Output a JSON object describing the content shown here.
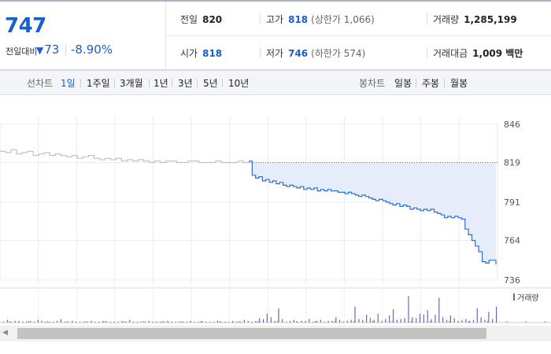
{
  "quote": {
    "price": "747",
    "change_label": "전일대비",
    "change_icon": "down-triangle-icon",
    "change_value": "73",
    "change_rate": "-8.90%",
    "prev_close_label": "전일",
    "prev_close": "820",
    "high_label": "고가",
    "high": "818",
    "upper_limit": "(상한가 1,066)",
    "volume_label": "거래량",
    "volume": "1,285,199",
    "open_label": "시가",
    "open": "818",
    "low_label": "저가",
    "low": "746",
    "lower_limit": "(하한가 574)",
    "amount_label": "거래대금",
    "amount": "1,009 백만"
  },
  "tabs": {
    "line_chart_label": "선차트",
    "line_periods": [
      "1일",
      "1주일",
      "3개월",
      "1년",
      "3년",
      "5년",
      "10년"
    ],
    "active_period": "1일",
    "candle_label": "봉차트",
    "candle_periods": [
      "일봉",
      "주봉",
      "월봉"
    ]
  },
  "colors": {
    "accent": "#1a5fd0",
    "today_line": "#2e6fd0",
    "prev_line": "#b7b7b7",
    "fill": "#e4edf9",
    "volume_bar": "#7b5fb5"
  },
  "chart_data": {
    "type": "line",
    "y_ticks": [
      "846",
      "819",
      "791",
      "764",
      "736"
    ],
    "ylim": [
      736,
      846
    ],
    "reference_value": 819,
    "legend": "거래량",
    "series": [
      {
        "values": [
          827,
          826,
          828,
          825,
          826,
          827,
          824,
          825,
          826,
          824,
          825,
          824,
          823,
          824,
          822,
          823,
          824,
          822,
          821,
          822,
          821,
          822,
          820,
          821,
          820,
          821,
          820,
          819,
          820,
          819,
          820,
          820,
          819,
          819,
          820,
          820,
          819,
          819,
          819,
          820,
          819,
          819,
          819,
          820,
          819,
          819
        ]
      },
      {
        "values": [
          820,
          810,
          808,
          809,
          806,
          807,
          805,
          806,
          804,
          805,
          803,
          802,
          803,
          802,
          801,
          802,
          800,
          801,
          800,
          801,
          799,
          800,
          799,
          800,
          799,
          799,
          798,
          798,
          797,
          798,
          797,
          796,
          795,
          796,
          795,
          794,
          793,
          792,
          793,
          792,
          791,
          790,
          789,
          790,
          788,
          789,
          788,
          786,
          787,
          786,
          785,
          786,
          785,
          786,
          784,
          783,
          782,
          780,
          781,
          780,
          781,
          780,
          779,
          772,
          768,
          764,
          760,
          756,
          749,
          748,
          750,
          750,
          747
        ]
      }
    ],
    "volume": [
      1,
      3,
      1,
      2,
      2,
      1,
      1,
      2,
      1,
      3,
      2,
      1,
      1,
      1,
      2,
      4,
      1,
      1,
      2,
      1,
      1,
      1,
      1,
      2,
      1,
      1,
      2,
      1,
      1,
      1,
      1,
      2,
      1,
      3,
      1,
      1,
      1,
      1,
      2,
      1,
      1,
      1,
      1,
      2,
      1,
      1,
      1,
      1,
      1,
      2,
      1,
      1,
      2,
      1,
      1,
      1,
      2,
      1,
      1,
      1,
      2,
      1,
      1,
      3,
      2,
      1,
      2,
      5,
      4,
      10,
      6,
      2,
      16,
      4,
      1,
      2,
      3,
      1,
      2,
      2,
      4,
      1,
      2,
      3,
      1,
      2,
      2,
      6,
      3,
      1,
      2,
      3,
      18,
      4,
      3,
      9,
      5,
      3,
      10,
      2,
      4,
      8,
      15,
      3,
      4,
      5,
      30,
      6,
      5,
      10,
      9,
      14,
      4,
      9,
      28,
      6,
      3,
      8,
      5,
      2,
      3,
      4,
      2,
      3,
      16,
      6,
      3,
      12,
      4,
      18
    ]
  }
}
